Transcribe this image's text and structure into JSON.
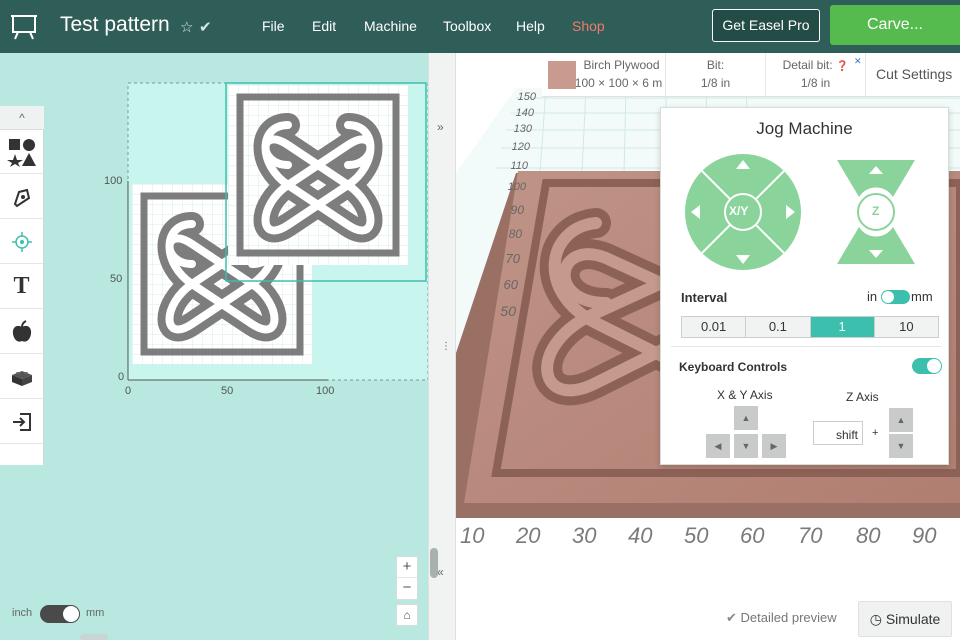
{
  "header": {
    "title": "Test pattern",
    "menu": [
      {
        "label": "File"
      },
      {
        "label": "Edit"
      },
      {
        "label": "Machine"
      },
      {
        "label": "Toolbox"
      },
      {
        "label": "Help"
      },
      {
        "label": "Shop"
      }
    ],
    "pro_button": "Get Easel Pro",
    "carve_button": "Carve..."
  },
  "colors": {
    "header_bg": "#2f5e58",
    "accent": "#3dbfae",
    "carve": "#55bb4e",
    "workspace_bg": "#b8e8df",
    "jog_green": "#8ad49b"
  },
  "tools": [
    {
      "icon": "shapes-icon"
    },
    {
      "icon": "pen-icon"
    },
    {
      "icon": "target-icon"
    },
    {
      "icon": "text-icon"
    },
    {
      "icon": "apple-icon"
    },
    {
      "icon": "block-icon"
    },
    {
      "icon": "import-icon"
    }
  ],
  "canvas": {
    "y_ticks": [
      "100",
      "50",
      "0"
    ],
    "x_ticks": [
      "0",
      "50",
      "100"
    ]
  },
  "unit_toggle": {
    "left": "inch",
    "right": "mm"
  },
  "info_bar": {
    "material_name": "Birch Plywood",
    "material_size": "100 × 100 × 6 m",
    "bit_label": "Bit:",
    "bit_value": "1/8 in",
    "detail_label": "Detail bit:",
    "detail_value": "1/8 in",
    "cut_settings": "Cut Settings"
  },
  "preview": {
    "y_ticks": [
      "150",
      "140",
      "130",
      "120",
      "110",
      "100",
      "90",
      "80",
      "70",
      "60",
      "50"
    ],
    "x_ticks": [
      "10",
      "20",
      "30",
      "40",
      "50",
      "60",
      "70",
      "80",
      "90"
    ],
    "detailed_preview": "Detailed preview",
    "simulate": "Simulate"
  },
  "jog": {
    "title": "Jog Machine",
    "xy_label": "X/Y",
    "z_label": "Z",
    "interval_label": "Interval",
    "unit_in": "in",
    "unit_mm": "mm",
    "intervals": [
      "0.01",
      "0.1",
      "1",
      "10"
    ],
    "active_interval": "1",
    "keyboard_label": "Keyboard Controls",
    "xy_axis": "X & Y Axis",
    "z_axis": "Z Axis",
    "shift": "shift",
    "plus": "+"
  }
}
